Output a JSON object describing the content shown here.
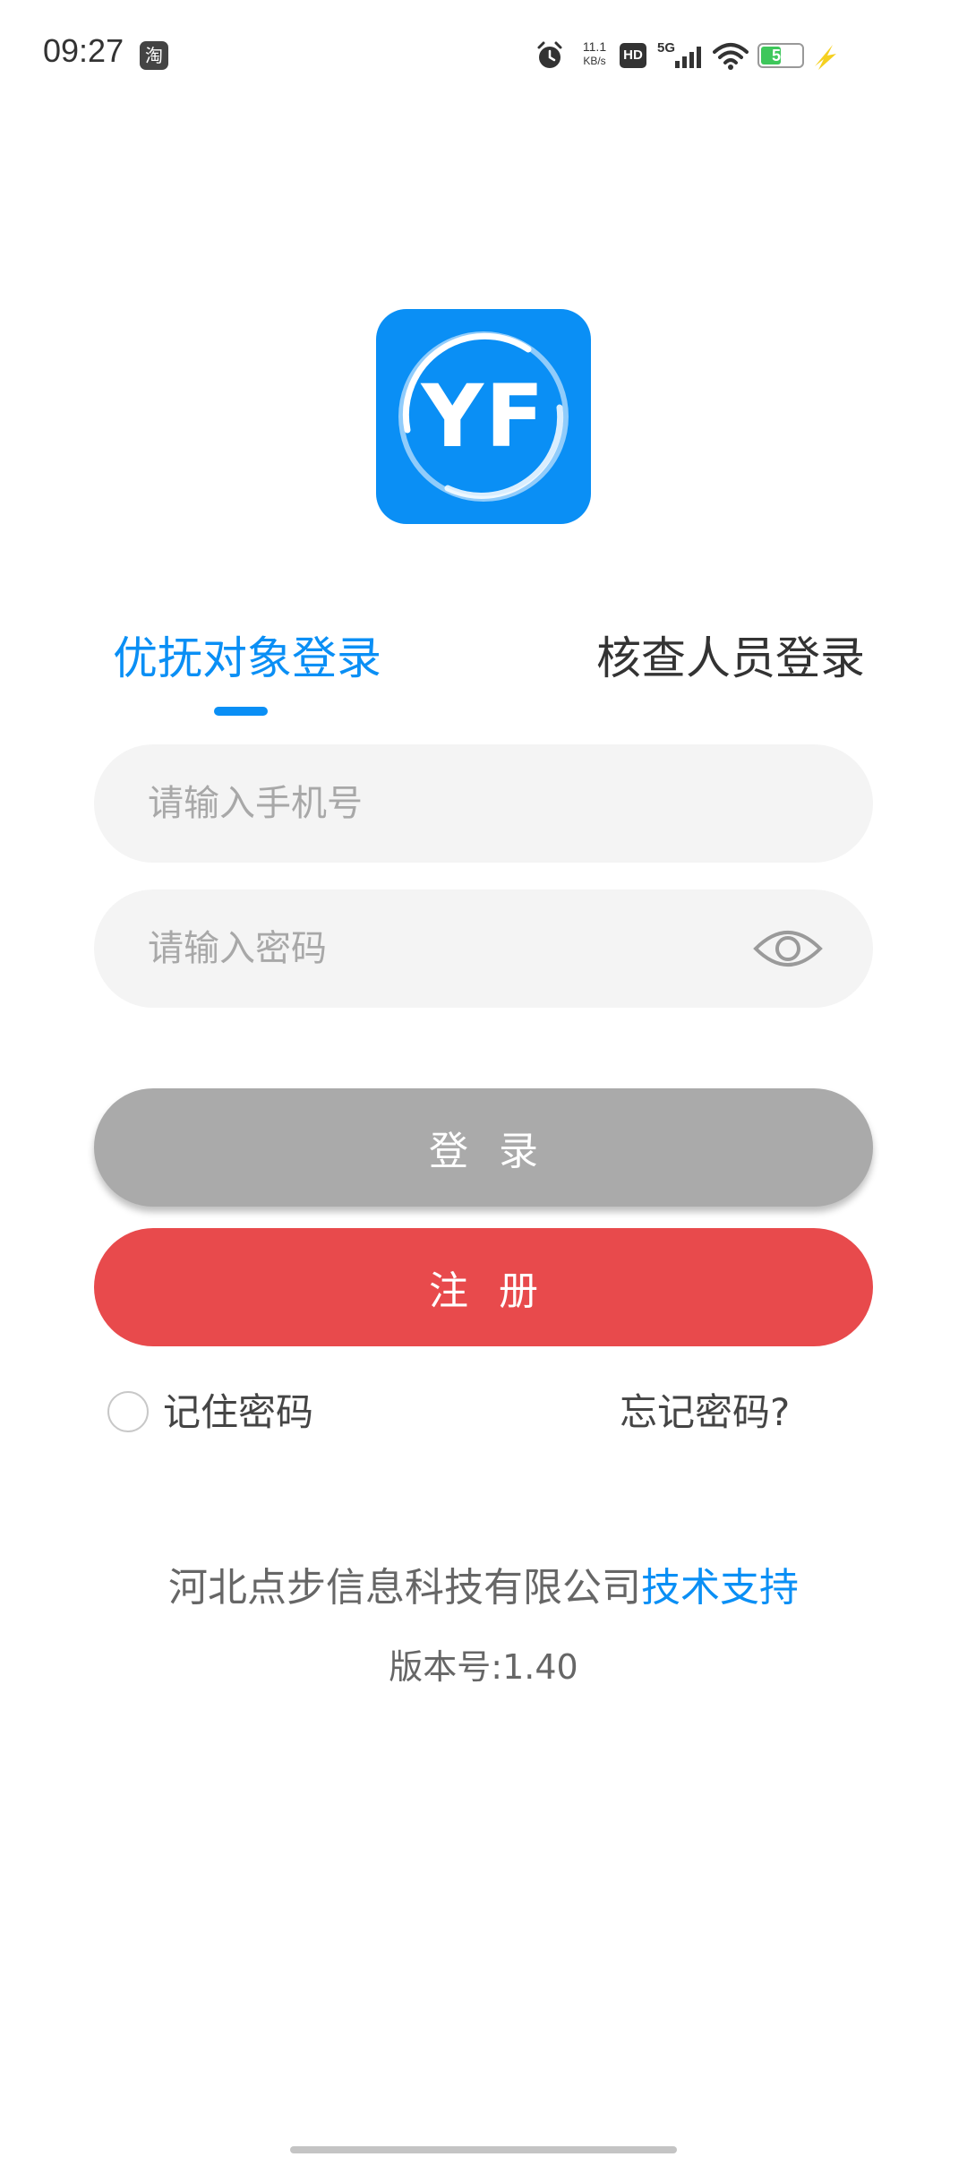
{
  "status_bar": {
    "time": "09:27",
    "taobao_badge": "淘",
    "net_speed_value": "11.1",
    "net_speed_unit": "KB/s",
    "hd_label": "HD",
    "network_label": "5G",
    "battery_level": "51",
    "battery_fill_fraction": 0.51,
    "battery_color": "#3ec75b"
  },
  "logo": {
    "text": "YF",
    "color": "#0a8ff5"
  },
  "tabs": [
    {
      "label": "优抚对象登录",
      "active": true
    },
    {
      "label": "核查人员登录",
      "active": false
    }
  ],
  "form": {
    "phone_placeholder": "请输入手机号",
    "password_placeholder": "请输入密码",
    "login_label": "登录",
    "register_label": "注册",
    "remember_label": "记住密码",
    "forgot_label": "忘记密码?"
  },
  "footer": {
    "company": "河北点步信息科技有限公司",
    "support": "技术支持",
    "version": "版本号:1.40"
  },
  "colors": {
    "accent": "#0a8ff5",
    "login_button": "#aaaaaa",
    "register_button": "#e84a4c",
    "input_background": "#f4f4f4"
  }
}
